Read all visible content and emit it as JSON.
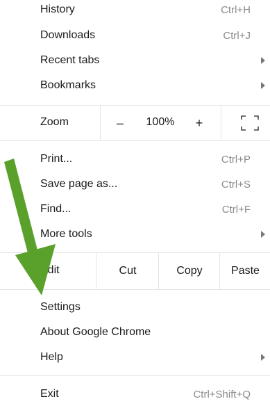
{
  "menu": {
    "history": {
      "label": "History",
      "shortcut": "Ctrl+H"
    },
    "downloads": {
      "label": "Downloads",
      "shortcut": "Ctrl+J"
    },
    "recent_tabs": {
      "label": "Recent tabs"
    },
    "bookmarks": {
      "label": "Bookmarks"
    },
    "zoom": {
      "label": "Zoom",
      "minus": "–",
      "value": "100%",
      "plus": "+"
    },
    "print": {
      "label": "Print...",
      "shortcut": "Ctrl+P"
    },
    "save_page": {
      "label": "Save page as...",
      "shortcut": "Ctrl+S"
    },
    "find": {
      "label": "Find...",
      "shortcut": "Ctrl+F"
    },
    "more_tools": {
      "label": "More tools"
    },
    "edit": {
      "label": "Edit",
      "cut": "Cut",
      "copy": "Copy",
      "paste": "Paste"
    },
    "settings": {
      "label": "Settings"
    },
    "about": {
      "label": "About Google Chrome"
    },
    "help": {
      "label": "Help"
    },
    "exit": {
      "label": "Exit",
      "shortcut": "Ctrl+Shift+Q"
    }
  },
  "colors": {
    "annotation_arrow": "#5aa12b",
    "separator": "#e4e4e4",
    "shortcut_text": "#8a8a8a"
  },
  "icons": {
    "fullscreen": "fullscreen-icon",
    "submenu": "chevron-right-icon"
  }
}
